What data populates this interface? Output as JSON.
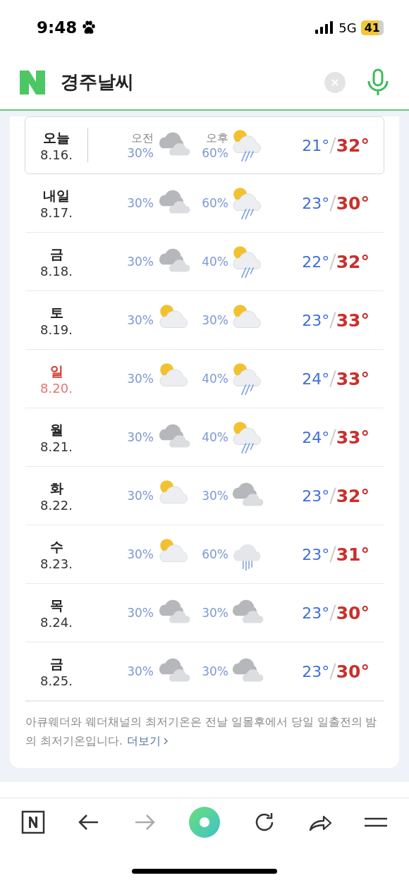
{
  "status_bar": {
    "time": "9:48",
    "network": "5G",
    "battery": "41"
  },
  "search": {
    "query": "경주날씨"
  },
  "forecast": [
    {
      "day": "오늘",
      "date": "8.16.",
      "selected": true,
      "holiday": false,
      "am": {
        "label": "오전",
        "rain": "30%",
        "kind": "cloudy"
      },
      "pm": {
        "label": "오후",
        "rain": "60%",
        "kind": "sun_rain"
      },
      "low": "21°",
      "high": "32°"
    },
    {
      "day": "내일",
      "date": "8.17.",
      "selected": false,
      "holiday": false,
      "am": {
        "rain": "30%",
        "kind": "cloudy"
      },
      "pm": {
        "rain": "60%",
        "kind": "sun_rain"
      },
      "low": "23°",
      "high": "30°"
    },
    {
      "day": "금",
      "date": "8.18.",
      "selected": false,
      "holiday": false,
      "am": {
        "rain": "30%",
        "kind": "cloudy"
      },
      "pm": {
        "rain": "40%",
        "kind": "sun_rain"
      },
      "low": "22°",
      "high": "32°"
    },
    {
      "day": "토",
      "date": "8.19.",
      "selected": false,
      "holiday": false,
      "am": {
        "rain": "30%",
        "kind": "partly_cloudy"
      },
      "pm": {
        "rain": "30%",
        "kind": "partly_cloudy"
      },
      "low": "23°",
      "high": "33°"
    },
    {
      "day": "일",
      "date": "8.20.",
      "selected": false,
      "holiday": true,
      "am": {
        "rain": "30%",
        "kind": "partly_cloudy"
      },
      "pm": {
        "rain": "40%",
        "kind": "sun_rain"
      },
      "low": "24°",
      "high": "33°"
    },
    {
      "day": "월",
      "date": "8.21.",
      "selected": false,
      "holiday": false,
      "am": {
        "rain": "30%",
        "kind": "cloudy"
      },
      "pm": {
        "rain": "40%",
        "kind": "sun_rain"
      },
      "low": "24°",
      "high": "33°"
    },
    {
      "day": "화",
      "date": "8.22.",
      "selected": false,
      "holiday": false,
      "am": {
        "rain": "30%",
        "kind": "partly_cloudy"
      },
      "pm": {
        "rain": "30%",
        "kind": "cloudy"
      },
      "low": "23°",
      "high": "32°"
    },
    {
      "day": "수",
      "date": "8.23.",
      "selected": false,
      "holiday": false,
      "am": {
        "rain": "30%",
        "kind": "partly_cloudy"
      },
      "pm": {
        "rain": "60%",
        "kind": "rain"
      },
      "low": "23°",
      "high": "31°"
    },
    {
      "day": "목",
      "date": "8.24.",
      "selected": false,
      "holiday": false,
      "am": {
        "rain": "30%",
        "kind": "cloudy"
      },
      "pm": {
        "rain": "30%",
        "kind": "cloudy"
      },
      "low": "23°",
      "high": "30°"
    },
    {
      "day": "금",
      "date": "8.25.",
      "selected": false,
      "holiday": false,
      "am": {
        "rain": "30%",
        "kind": "cloudy"
      },
      "pm": {
        "rain": "30%",
        "kind": "cloudy"
      },
      "low": "23°",
      "high": "30°"
    }
  ],
  "note": {
    "text": "아큐웨더와 웨더채널의 최저기온은 전날 일몰후에서 당일 일출전의 밤의 최저기온입니다.",
    "link": "더보기"
  },
  "toolbar": [
    {
      "kind": "home"
    },
    {
      "kind": "back",
      "disabled": false
    },
    {
      "kind": "forward",
      "disabled": true
    },
    {
      "kind": "green"
    },
    {
      "kind": "reload"
    },
    {
      "kind": "share"
    },
    {
      "kind": "menu"
    }
  ]
}
